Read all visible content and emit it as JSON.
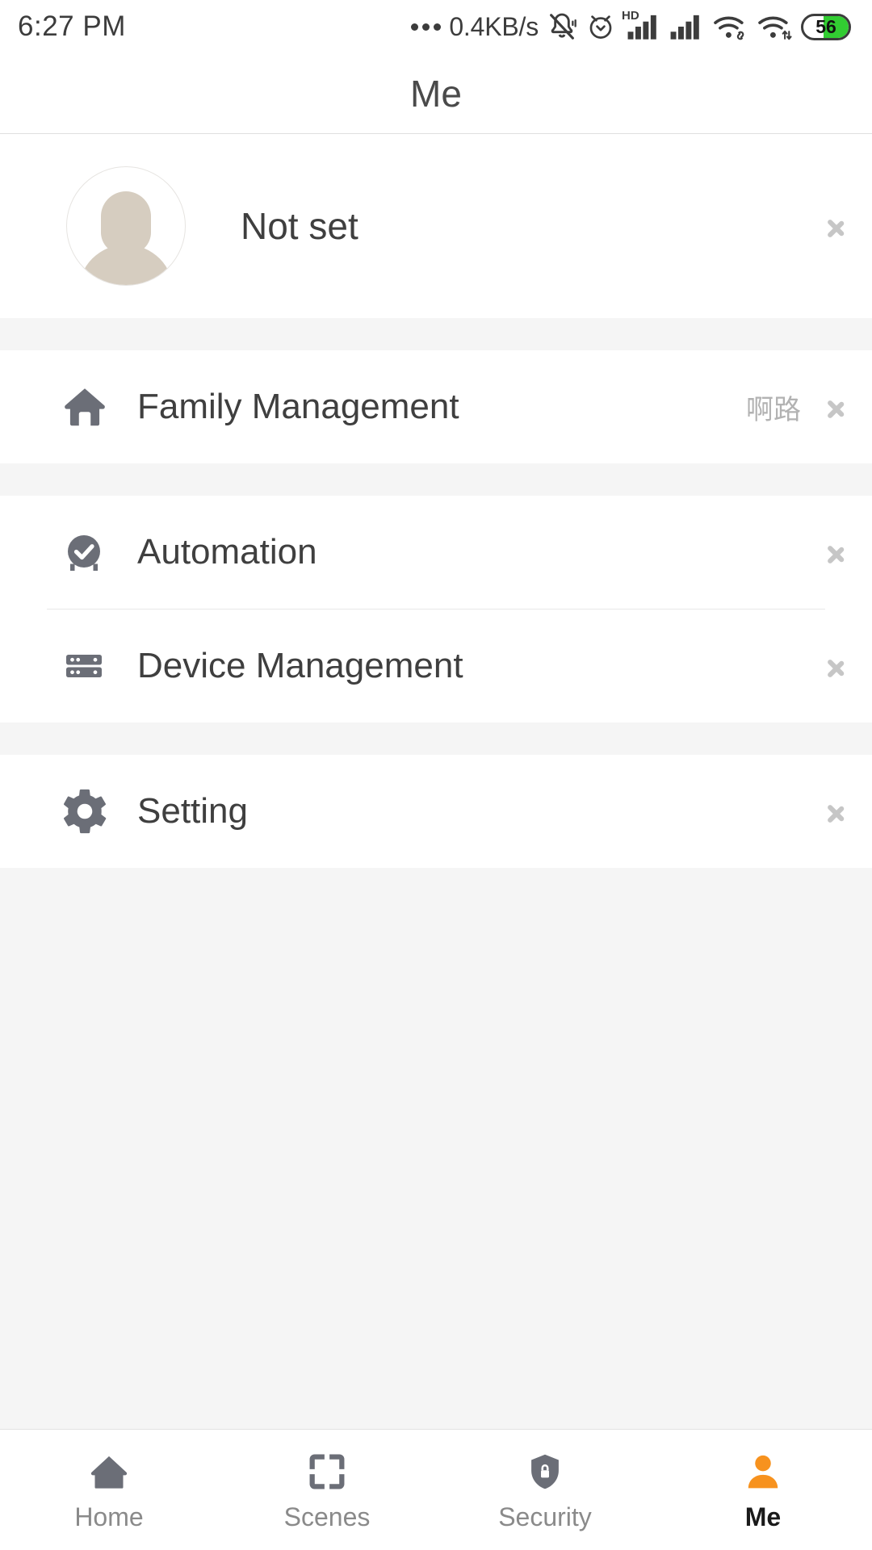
{
  "status_bar": {
    "time": "6:27 PM",
    "network_rate": "0.4KB/s",
    "icons": [
      "more-dots-icon",
      "network-rate-text",
      "silent-bell-icon",
      "alarm-clock-icon",
      "hd-signal-icon",
      "signal-bars-icon",
      "wifi-link-icon",
      "wifi-transfer-icon",
      "battery-icon"
    ],
    "battery": {
      "level": "56",
      "percent": 56,
      "fill_color": "#32cd32"
    }
  },
  "header": {
    "title": "Me"
  },
  "profile": {
    "name": "Not set",
    "avatar_icon": "person-placeholder-avatar",
    "chevron": "chevron-right-icon"
  },
  "sections": [
    {
      "rows": [
        {
          "icon": "home-icon",
          "label": "Family Management",
          "value": "啊路",
          "chevron": "chevron-right-icon"
        }
      ]
    },
    {
      "rows": [
        {
          "icon": "check-circle-icon",
          "label": "Automation",
          "value": "",
          "chevron": "chevron-right-icon"
        },
        {
          "icon": "server-rack-icon",
          "label": "Device Management",
          "value": "",
          "chevron": "chevron-right-icon"
        }
      ]
    },
    {
      "rows": [
        {
          "icon": "gear-icon",
          "label": "Setting",
          "value": "",
          "chevron": "chevron-right-icon"
        }
      ]
    }
  ],
  "bottom_nav": {
    "active": "Me",
    "items": [
      {
        "label": "Home",
        "icon": "home-nav-icon"
      },
      {
        "label": "Scenes",
        "icon": "scan-frame-icon"
      },
      {
        "label": "Security",
        "icon": "shield-lock-icon"
      },
      {
        "label": "Me",
        "icon": "person-icon"
      }
    ],
    "active_color": "#f7921e",
    "inactive_color": "#8a8a8a"
  },
  "colors": {
    "page_background": "#f5f5f5",
    "card_background": "#ffffff",
    "primary_text": "#3f3f3f",
    "secondary_text": "#b2b2b2",
    "icon_gray": "#6b6e77",
    "accent_orange": "#f7921e"
  }
}
